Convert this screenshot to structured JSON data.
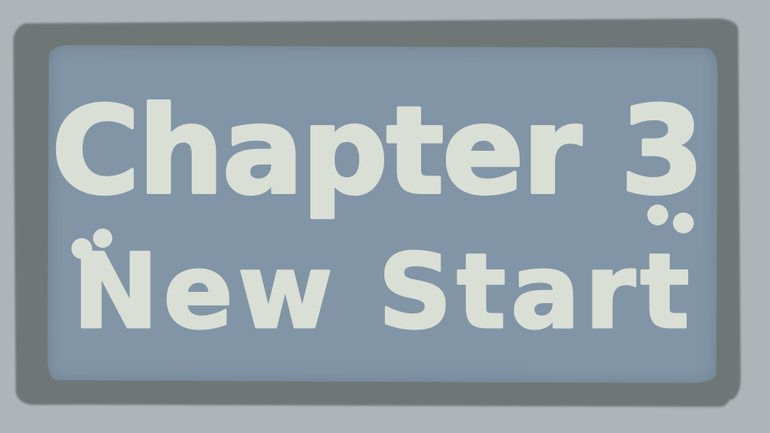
{
  "screen": {
    "type": "chapter-title-card",
    "colors": {
      "background": "#aeb5b8",
      "frame": "#6e7775",
      "panel": "#8195a6",
      "text": "#d9dfd5"
    }
  },
  "title": {
    "chapter_label": "Chapter 3",
    "subtitle": "New Start",
    "open_quote": "“",
    "close_quote": "”"
  }
}
